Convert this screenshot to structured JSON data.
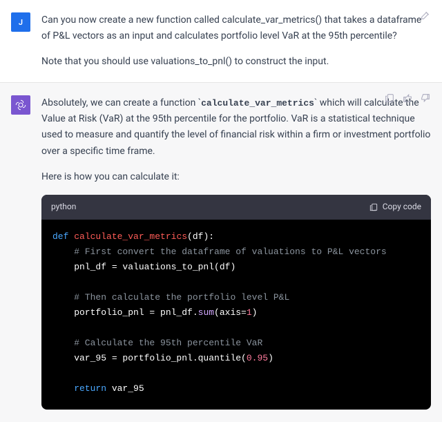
{
  "user": {
    "avatar_letter": "J",
    "paragraph1": "Can you now create a new function called calculate_var_metrics() that takes a dataframe of P&L vectors as an input and calculates portfolio level VaR at the 95th percentile?",
    "paragraph2": "Note that you should use valuations_to_pnl() to construct the input."
  },
  "assistant": {
    "para1_pre": "Absolutely, we can create a function `",
    "para1_code": "calculate_var_metrics",
    "para1_post": "` which will calculate the Value at Risk (VaR) at the 95th percentile for the portfolio. VaR is a statistical technique used to measure and quantify the level of financial risk within a firm or investment portfolio over a specific time frame.",
    "para2": "Here is how you can calculate it:"
  },
  "code": {
    "language": "python",
    "copy_label": "Copy code",
    "l1": {
      "kw": "def ",
      "fn": "calculate_var_metrics",
      "rest": "(df):"
    },
    "l2": "    # First convert the dataframe of valuations to P&L vectors",
    "l3": "    pnl_df = valuations_to_pnl(df)",
    "l5": "    # Then calculate the portfolio level P&L",
    "l6_pre": "    portfolio_pnl = pnl_df.",
    "l6_call": "sum",
    "l6_post": "(axis=",
    "l6_num": "1",
    "l6_end": ")",
    "l8": "    # Calculate the 95th percentile VaR",
    "l9_pre": "    var_95 = portfolio_pnl.quantile(",
    "l9_num": "0.95",
    "l9_end": ")",
    "l11_kw": "    return",
    "l11_rest": " var_95"
  }
}
